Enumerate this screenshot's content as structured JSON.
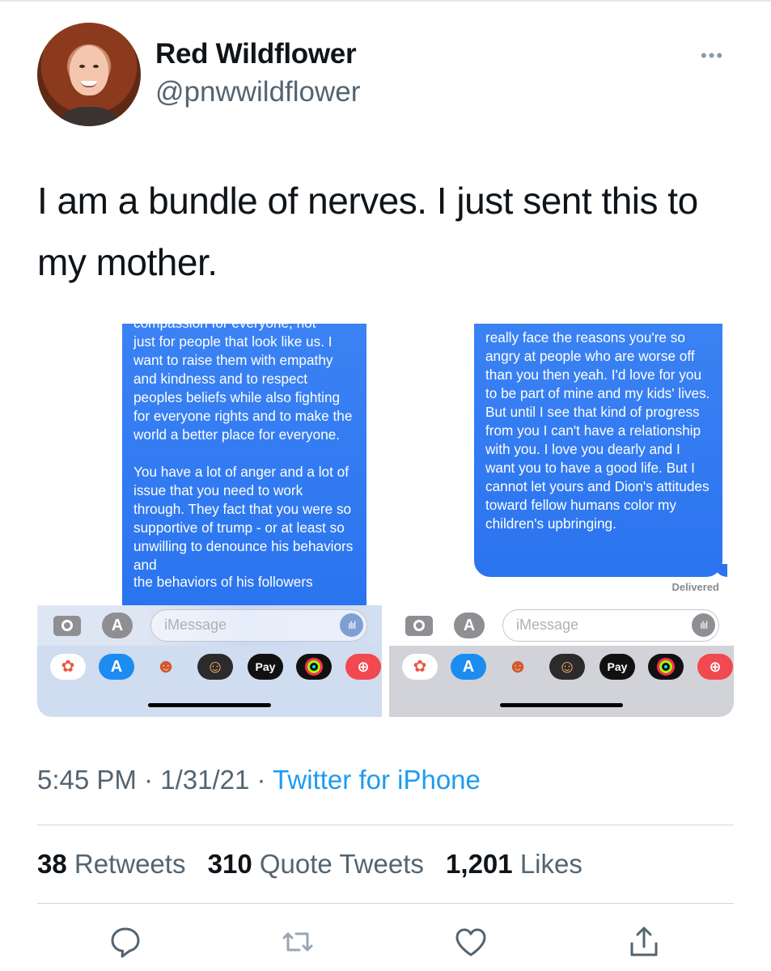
{
  "user": {
    "display_name": "Red Wildflower",
    "handle": "@pnwwildflower"
  },
  "tweet": {
    "text": "I am a bundle of nerves. I just sent this to my mother."
  },
  "screenshots": {
    "left": {
      "clipped_line": "compassion for everyone, not",
      "message": "just for people that look like us. I want to raise them with empathy and kindness and to respect peoples beliefs while also fighting for everyone rights and to make the world a better place for everyone.\n\nYou have a lot of anger and a lot of issue that you need to work through. They fact that you were so supportive of trump - or at least so unwilling to denounce his behaviors and",
      "clipped_bottom": "the behaviors of his followers"
    },
    "right": {
      "message": "really face the reasons you're so angry at people who are worse off than you then yeah. I'd love for you to be part of mine and my kids' lives. But until I see that kind of progress from you I can't have a relationship with you. I love you dearly and I want you to have a good life. But I cannot let yours and Dion's attitudes toward fellow humans color my children's upbringing.",
      "status": "Delivered"
    },
    "input_placeholder": "iMessage",
    "app_drawer": [
      "photos-icon",
      "app-store-icon",
      "memoji-icon",
      "memoji-stickers-icon",
      "apple-pay-icon",
      "activity-icon",
      "web-search-icon"
    ],
    "pay_label": "Pay"
  },
  "meta": {
    "time": "5:45 PM",
    "date": "1/31/21",
    "source": "Twitter for iPhone"
  },
  "stats": {
    "retweets_count": "38",
    "retweets_label": "Retweets",
    "quotes_count": "310",
    "quotes_label": "Quote Tweets",
    "likes_count": "1,201",
    "likes_label": "Likes"
  },
  "colors": {
    "link": "#1d9bf0",
    "bubble": "#2f7af1",
    "secondary_text": "#536471"
  }
}
